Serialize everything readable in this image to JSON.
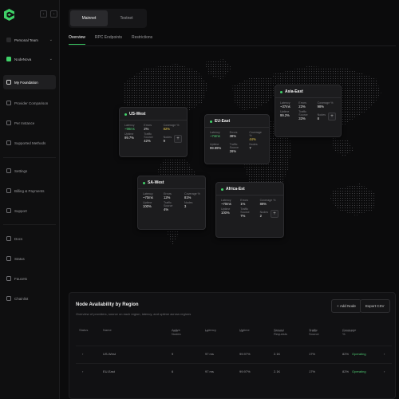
{
  "sidebar": {
    "team": "Personal Team",
    "project": "NodeNova",
    "items_main": [
      {
        "label": "My Foundation",
        "icon": "home-icon",
        "active": true
      },
      {
        "label": "Provider Comparison",
        "icon": "compare-icon",
        "active": false
      },
      {
        "label": "Per Instance",
        "icon": "instance-icon",
        "active": false
      },
      {
        "label": "Supported Methods",
        "icon": "methods-icon",
        "active": false
      }
    ],
    "items_account": [
      {
        "label": "Settings",
        "icon": "gear-icon"
      },
      {
        "label": "Billing & Payments",
        "icon": "card-icon"
      },
      {
        "label": "Support",
        "icon": "support-icon"
      }
    ],
    "items_resources": [
      {
        "label": "Docs",
        "icon": "docs-icon"
      },
      {
        "label": "Status",
        "icon": "status-icon"
      },
      {
        "label": "Faucets",
        "icon": "faucet-icon"
      },
      {
        "label": "Chainlist",
        "icon": "chain-icon"
      }
    ]
  },
  "network_toggle": {
    "mainnet": "Mainnet",
    "testnet": "Testnet"
  },
  "tabs": [
    "Overview",
    "RPC Endpoints",
    "Restrictions"
  ],
  "regions": [
    {
      "name": "US-West",
      "latency_label": "Latency",
      "latency": "~98ms",
      "errors_label": "Errors",
      "errors": "2%",
      "coverage_label": "Coverage %",
      "coverage": "82%",
      "uptime_label": "Uptime",
      "uptime": "99.7%",
      "traffic_label": "Traffic Source",
      "traffic": "42%",
      "nodes_label": "Nodes",
      "nodes": "9"
    },
    {
      "name": "EU-East",
      "latency_label": "Latency",
      "latency": "~74ms",
      "errors_label": "Errors",
      "errors": "38%",
      "coverage_label": "Coverage %",
      "coverage": "44%",
      "uptime_label": "Uptime",
      "uptime": "99.99%",
      "traffic_label": "Traffic Source",
      "traffic": "26%",
      "nodes_label": "Nodes",
      "nodes": "7"
    },
    {
      "name": "Asia-East",
      "latency_label": "Latency",
      "latency": "~37ms",
      "errors_label": "Errors",
      "errors": "23%",
      "coverage_label": "Coverage %",
      "coverage": "98%",
      "uptime_label": "Uptime",
      "uptime": "99.2%",
      "traffic_label": "Traffic Source",
      "traffic": "33%",
      "nodes_label": "Nodes",
      "nodes": "8"
    },
    {
      "name": "SA-West",
      "latency_label": "Latency",
      "latency": "~70ms",
      "errors_label": "Errors",
      "errors": "12%",
      "coverage_label": "Coverage %",
      "coverage": "81%",
      "uptime_label": "Uptime",
      "uptime": "100%",
      "traffic_label": "Traffic Source",
      "traffic": "4%",
      "nodes_label": "Nodes",
      "nodes": "3"
    },
    {
      "name": "Africa-Est",
      "latency_label": "Latency",
      "latency": "~70ms",
      "errors_label": "Errors",
      "errors": "1%",
      "coverage_label": "Coverage %",
      "coverage": "88%",
      "uptime_label": "Uptime",
      "uptime": "100%",
      "traffic_label": "Traffic Source",
      "traffic": "7%",
      "nodes_label": "Nodes",
      "nodes": "2"
    }
  ],
  "availability": {
    "title": "Node Availability by Region",
    "subtitle": "Overview of providers, source on each region, latency, and uptime across regions",
    "add_button": "Add Node",
    "export_button": "Export CSV",
    "columns": [
      {
        "label": "Status",
        "sub": ""
      },
      {
        "label": "Name",
        "sub": ""
      },
      {
        "label": "Active Nodes",
        "sub": "/ total"
      },
      {
        "label": "Latency",
        "sub": "ms"
      },
      {
        "label": "Uptime",
        "sub": "30d"
      },
      {
        "label": "Served Requests",
        "sub": "24 hours"
      },
      {
        "label": "Traffic Source",
        "sub": "% total"
      },
      {
        "label": "Coverage %",
        "sub": "24 hours"
      }
    ],
    "rows": [
      {
        "name": "US-West",
        "active": "9",
        "latency": "97 ms",
        "uptime": "99.97%",
        "served": "2.1K",
        "traffic": "17%",
        "coverage": "82%",
        "status_text": "Operating"
      },
      {
        "name": "EU-East",
        "active": "6",
        "latency": "97 ms",
        "uptime": "99.97%",
        "served": "2.1K",
        "traffic": "17%",
        "coverage": "82%",
        "status_text": "Operating"
      }
    ]
  }
}
